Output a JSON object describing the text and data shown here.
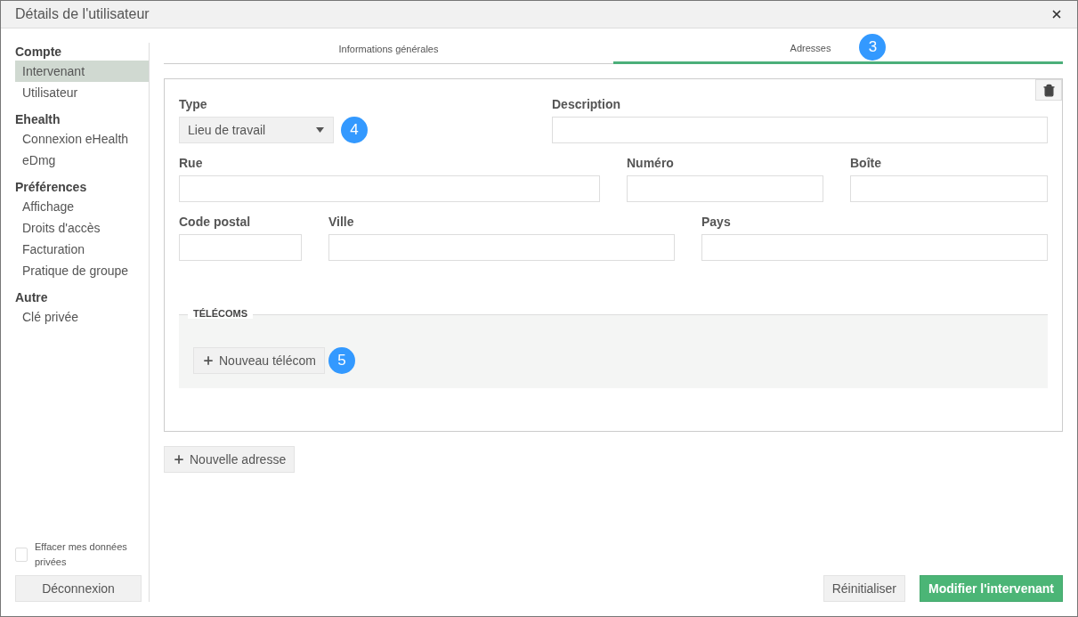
{
  "window": {
    "title": "Détails de l'utilisateur"
  },
  "sidebar": {
    "sections": [
      {
        "heading": "Compte",
        "items": [
          {
            "label": "Intervenant",
            "selected": true
          },
          {
            "label": "Utilisateur",
            "selected": false
          }
        ]
      },
      {
        "heading": "Ehealth",
        "items": [
          {
            "label": "Connexion eHealth",
            "selected": false
          },
          {
            "label": "eDmg",
            "selected": false
          }
        ]
      },
      {
        "heading": "Préférences",
        "items": [
          {
            "label": "Affichage",
            "selected": false
          },
          {
            "label": "Droits d'accès",
            "selected": false
          },
          {
            "label": "Facturation",
            "selected": false
          },
          {
            "label": "Pratique de groupe",
            "selected": false
          }
        ]
      },
      {
        "heading": "Autre",
        "items": [
          {
            "label": "Clé privée",
            "selected": false
          }
        ]
      }
    ],
    "clear_data": {
      "label": "Effacer mes données privées",
      "checked": false
    },
    "logout": "Déconnexion"
  },
  "tabs": [
    {
      "label": "Informations générales",
      "selected": false
    },
    {
      "label": "Adresses",
      "selected": true,
      "badge": "3"
    }
  ],
  "address": {
    "type": {
      "label": "Type",
      "value": "Lieu de travail",
      "badge": "4"
    },
    "description": {
      "label": "Description"
    },
    "rows": [
      [
        {
          "label": "Rue"
        },
        {
          "label": "Numéro"
        },
        {
          "label": "Boîte"
        }
      ],
      [
        {
          "label": "Code postal"
        },
        {
          "label": "Ville"
        },
        {
          "label": "Pays"
        }
      ]
    ],
    "telecoms": {
      "title": "TÉLÉCOMS",
      "button": "Nouveau télécom",
      "badge": "5"
    }
  },
  "new_address": "Nouvelle adresse",
  "footer": [
    {
      "label": "Réinitialiser",
      "kind": "secondary"
    },
    {
      "label": "Modifier l'intervenant",
      "kind": "primary"
    }
  ]
}
